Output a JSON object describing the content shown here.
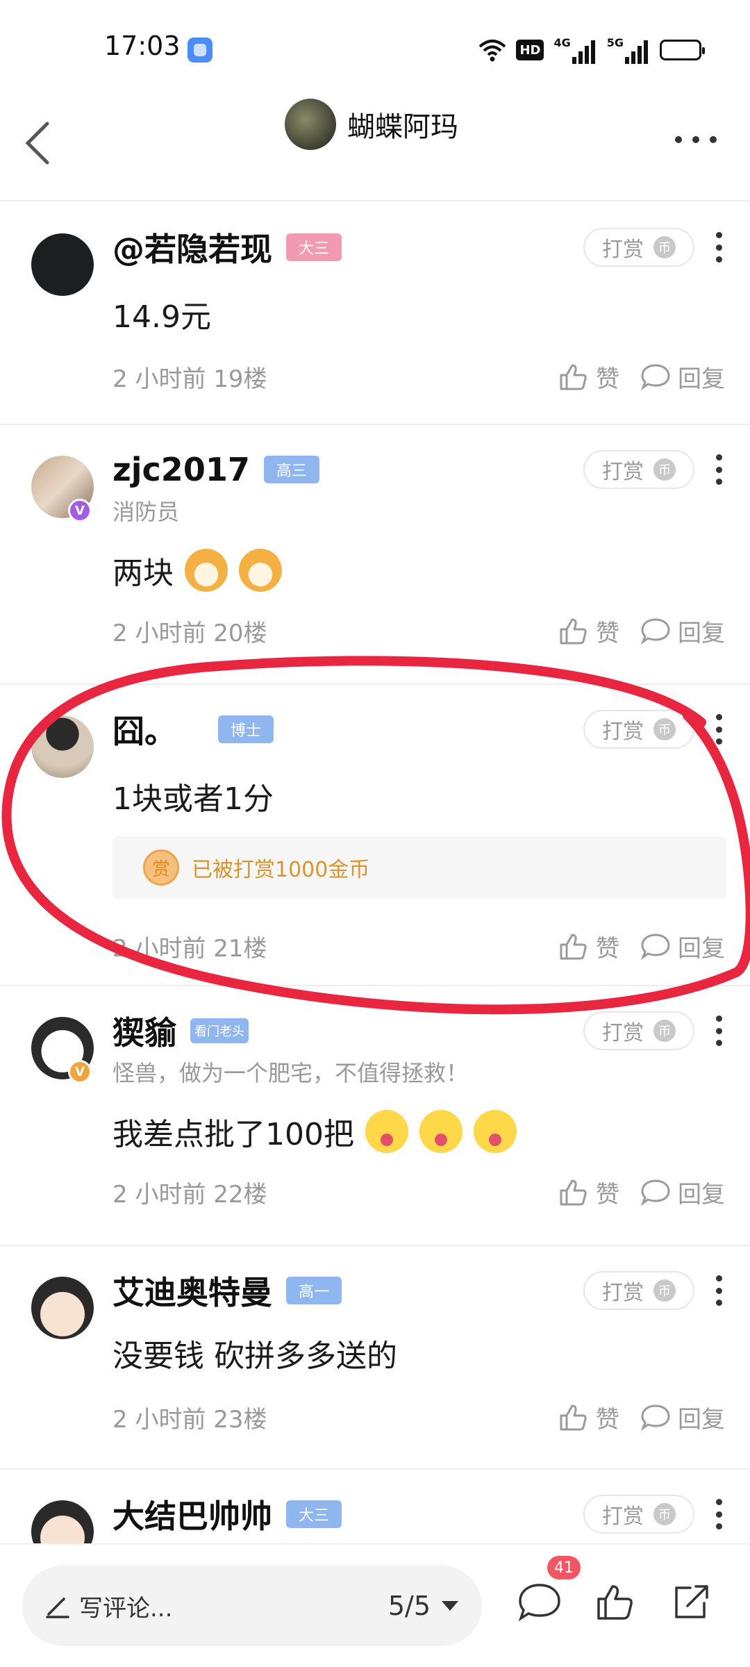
{
  "status_bar": {
    "time": "17:03",
    "hd_label": "HD",
    "net1": "4G",
    "net2": "5G",
    "battery_level": 0.6
  },
  "header": {
    "title": "蝴蝶阿玛"
  },
  "tip_label": "打赏",
  "like_label": "赞",
  "reply_label": "回复",
  "comments": [
    {
      "name": "@若隐若现",
      "badge": "大三",
      "badge_color": "#f39ab3",
      "text": "14.9元",
      "meta": "2 小时前  19楼"
    },
    {
      "name": "zjc2017",
      "badge": "高三",
      "badge_color": "#8fb6ef",
      "subtitle": "消防员",
      "text": "两块",
      "meta": "2 小时前  20楼"
    },
    {
      "name": "囧。",
      "badge": "博士",
      "badge_color": "#8fb6ef",
      "text": "1块或者1分",
      "reward": "已被打赏1000金币",
      "reward_icon": "赏",
      "meta": "2 小时前  21楼"
    },
    {
      "name": "猰貐",
      "badge": "看门老头",
      "badge_color": "#8fb6ef",
      "subtitle": "怪兽，做为一个肥宅，不值得拯救！",
      "text": "我差点批了100把",
      "meta": "2 小时前  22楼"
    },
    {
      "name": "艾迪奥特曼",
      "badge": "高一",
      "badge_color": "#8fb6ef",
      "text": "没要钱  砍拼多多送的",
      "meta": "2 小时前  23楼"
    },
    {
      "name": "大结巴帅帅",
      "badge": "大三",
      "badge_color": "#8fb6ef"
    }
  ],
  "bottom_bar": {
    "placeholder": "写评论...",
    "page_indicator": "5/5",
    "comment_count": "41"
  },
  "colors": {
    "annotation": "#e8263f",
    "reward_text": "#d9942e"
  }
}
